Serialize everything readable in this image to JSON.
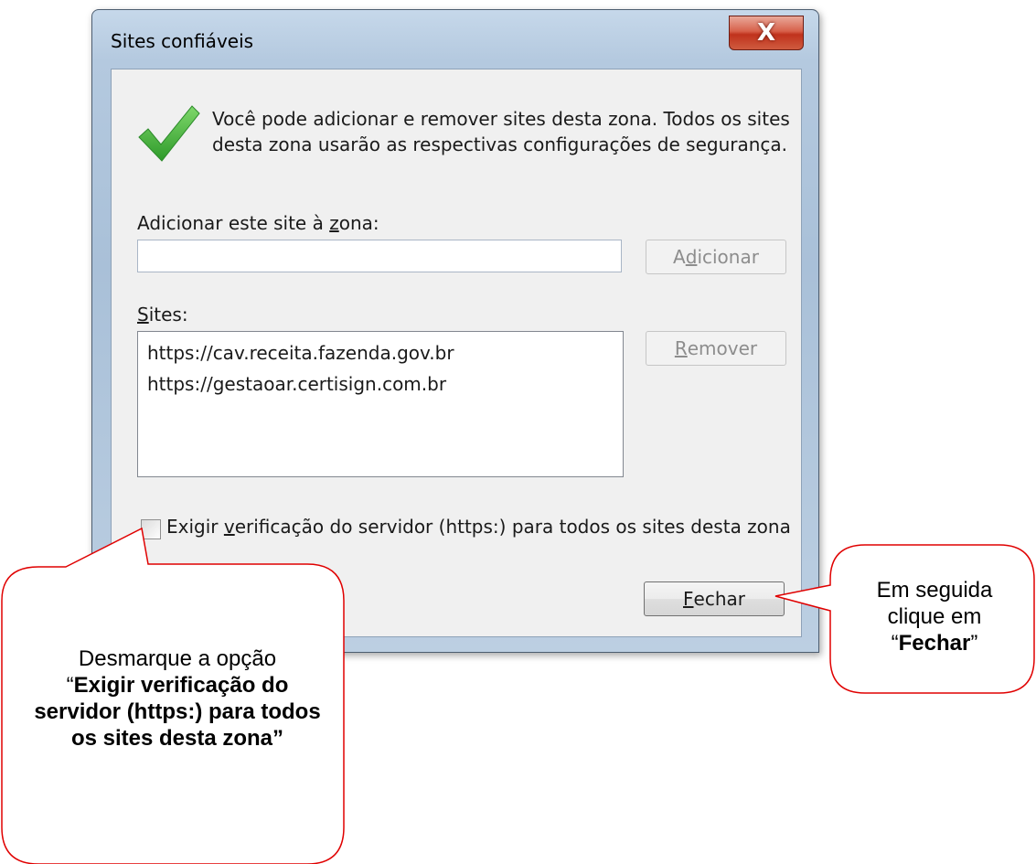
{
  "window": {
    "title": "Sites confiáveis",
    "close_glyph": "X"
  },
  "intro_text": "Você pode adicionar e remover sites desta zona. Todos os sites desta zona usarão as respectivas configurações de segurança.",
  "icons": {
    "zone": "green-checkmark-icon",
    "close": "close-icon"
  },
  "add_site": {
    "label_prefix": "Adicionar este site à ",
    "label_hotkey": "z",
    "label_suffix": "ona:",
    "input_value": "",
    "button_prefix": "A",
    "button_hotkey": "d",
    "button_suffix": "icionar"
  },
  "sites": {
    "label_hotkey": "S",
    "label_suffix": "ites:",
    "items": [
      "https://cav.receita.fazenda.gov.br",
      "https://gestaoar.certisign.com.br"
    ],
    "remove_hotkey": "R",
    "remove_suffix": "emover"
  },
  "require_https": {
    "checked": false,
    "label_prefix": "Exigir ",
    "label_hotkey": "v",
    "label_suffix": "erificação do servidor (https:) para todos os sites desta zona"
  },
  "close_button": {
    "hotkey": "F",
    "suffix": "echar"
  },
  "callouts": {
    "left": {
      "line1": "Desmarque a opção",
      "open_quote": "“",
      "bold": "Exigir verificação do servidor (https:) para todos os sites desta zona”"
    },
    "right": {
      "line1": "Em seguida",
      "line2": "clique em",
      "open_quote": "“",
      "bold": "Fechar",
      "close_quote": "”"
    }
  },
  "colors": {
    "callout_border": "#e00000",
    "check_green": "#3aa835",
    "close_red": "#c8391f"
  }
}
